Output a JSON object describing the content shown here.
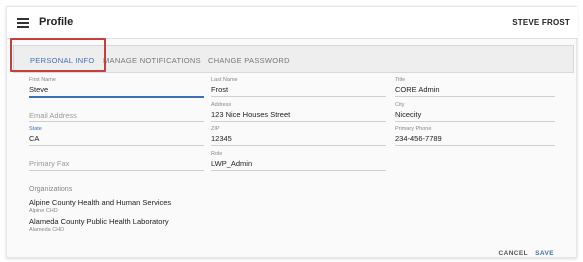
{
  "header": {
    "title": "Profile",
    "user_name": "STEVE FROST"
  },
  "tabs": [
    {
      "label": "PERSONAL INFO",
      "active": true
    },
    {
      "label": "MANAGE NOTIFICATIONS",
      "active": false
    },
    {
      "label": "CHANGE PASSWORD",
      "active": false
    }
  ],
  "form": {
    "first_name": {
      "label": "First Name",
      "value": "Steve"
    },
    "last_name": {
      "label": "Last Name",
      "value": "Frost"
    },
    "title": {
      "label": "Title",
      "value": "CORE Admin"
    },
    "email": {
      "placeholder": "Email Address",
      "value": ""
    },
    "address": {
      "label": "Address",
      "value": "123 Nice Houses Street"
    },
    "city": {
      "label": "City",
      "value": "Nicecity"
    },
    "state": {
      "label": "State",
      "value": "CA"
    },
    "zip": {
      "label": "ZIP",
      "value": "12345"
    },
    "primary_phone": {
      "label": "Primary Phone",
      "value": "234-456-7789"
    },
    "primary_fax": {
      "placeholder": "Primary Fax",
      "value": ""
    },
    "role": {
      "label": "Role",
      "value": "LWP_Admin"
    }
  },
  "organizations": {
    "header": "Organizations",
    "items": [
      {
        "name": "Alpine County Health and Human Services",
        "code": "Alpine CHD"
      },
      {
        "name": "Alameda County Public Health Laboratory",
        "code": "Alameda CHD"
      }
    ]
  },
  "actions": {
    "cancel_label": "CANCEL",
    "save_label": "SAVE"
  },
  "colors": {
    "accent": "#3f6fb4",
    "highlight_box": "#c4403e"
  }
}
